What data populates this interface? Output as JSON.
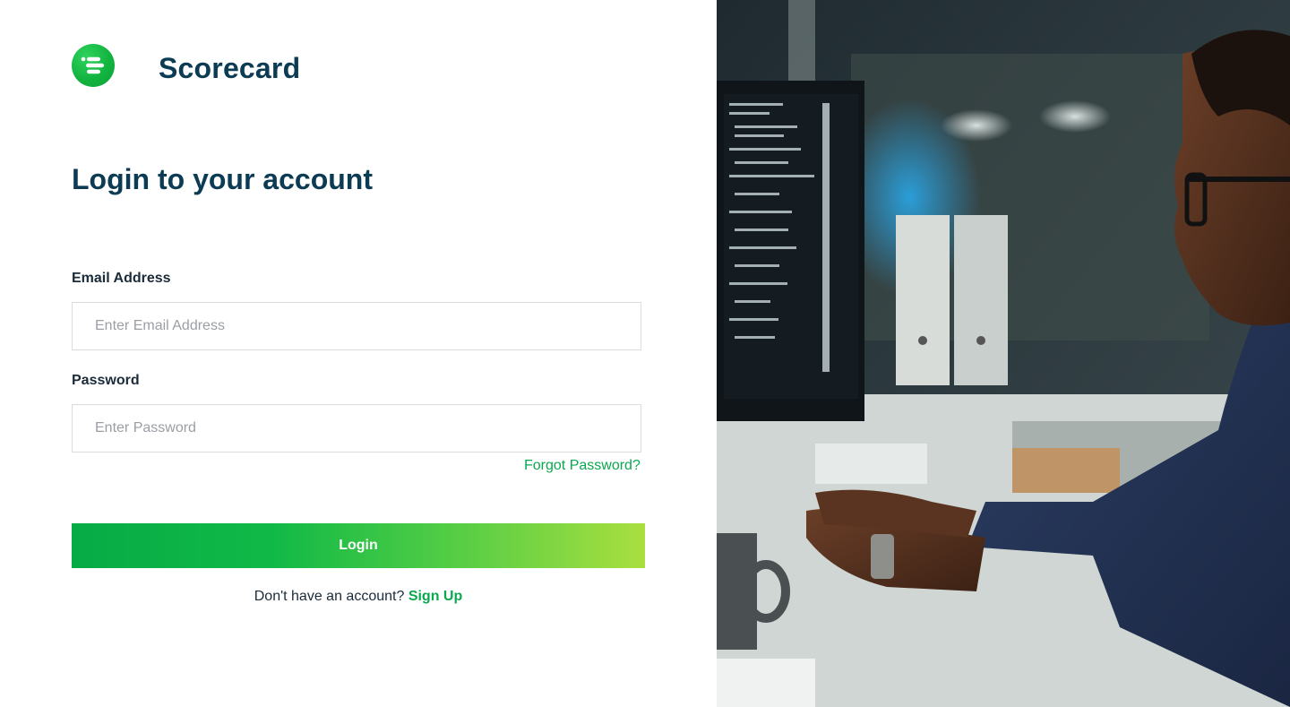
{
  "brand": {
    "name": "Scorecard",
    "logo_icon": "menu-lines-icon",
    "accent": "#12b43f"
  },
  "login": {
    "title": "Login to your account",
    "email_label": "Email Address",
    "email_placeholder": "Enter Email Address",
    "email_value": "",
    "password_label": "Password",
    "password_placeholder": "Enter Password",
    "password_value": "",
    "forgot_link": "Forgot Password?",
    "submit_label": "Login",
    "signup_prompt": "Don't have an account?",
    "signup_link": "Sign Up"
  },
  "colors": {
    "heading": "#0c3b54",
    "link": "#0aa84f",
    "button_gradient_start": "#07ab46",
    "button_gradient_end": "#aadf3f"
  }
}
